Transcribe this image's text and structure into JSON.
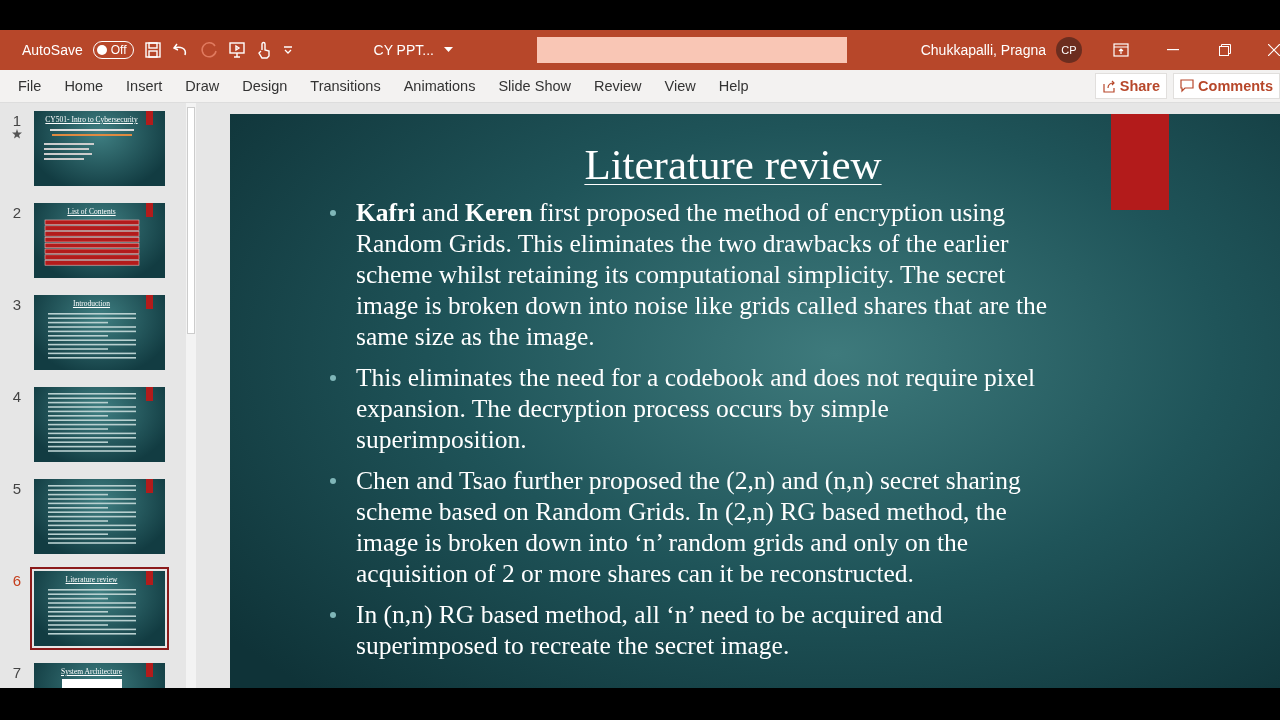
{
  "title_bar": {
    "autosave_label": "AutoSave",
    "autosave_toggle": {
      "label": "Off",
      "on": false
    },
    "file_name": "CY PPT...",
    "user_name": "Chukkapalli, Pragna",
    "avatar_initials": "CP"
  },
  "ribbon_tabs": [
    "File",
    "Home",
    "Insert",
    "Draw",
    "Design",
    "Transitions",
    "Animations",
    "Slide Show",
    "Review",
    "View",
    "Help"
  ],
  "ribbon_buttons": [
    "Share",
    "Comments"
  ],
  "slides": [
    {
      "number": "1",
      "kind": "cover",
      "title": "CY501- Intro to Cybersecurity",
      "starred": true,
      "selected": false
    },
    {
      "number": "2",
      "kind": "list",
      "title": "List of Contents",
      "starred": false,
      "selected": false
    },
    {
      "number": "3",
      "kind": "bullets",
      "title": "Introduction",
      "starred": false,
      "selected": false
    },
    {
      "number": "4",
      "kind": "bullets",
      "starred": false,
      "selected": false
    },
    {
      "number": "5",
      "kind": "bullets",
      "starred": false,
      "selected": false
    },
    {
      "number": "6",
      "kind": "bullets",
      "title": "Literature review",
      "starred": false,
      "selected": true
    },
    {
      "number": "7",
      "kind": "diagram",
      "title": "System Architecture",
      "starred": false,
      "selected": false
    }
  ],
  "current_slide": {
    "title": "Literature review",
    "bullets": [
      "**Kafri** and **Keren** first proposed the method of encryption using Random Grids. This eliminates the two drawbacks of the earlier scheme whilst retaining its computational simplicity. The secret image is broken down into noise like grids called shares that are the same size as the image.",
      "This eliminates the need for a codebook and does not require pixel expansion. The decryption process occurs by simple superimposition.",
      "Chen and Tsao further proposed the (2,n) and (n,n) secret sharing scheme based on Random Grids. In (2,n) RG based method, the image is broken down into ‘n’ random grids and only on the acquisition of 2 or more shares can it be reconstructed.",
      "In (n,n) RG based method, all ‘n’ need to be acquired and superimposed to recreate the secret image."
    ]
  }
}
